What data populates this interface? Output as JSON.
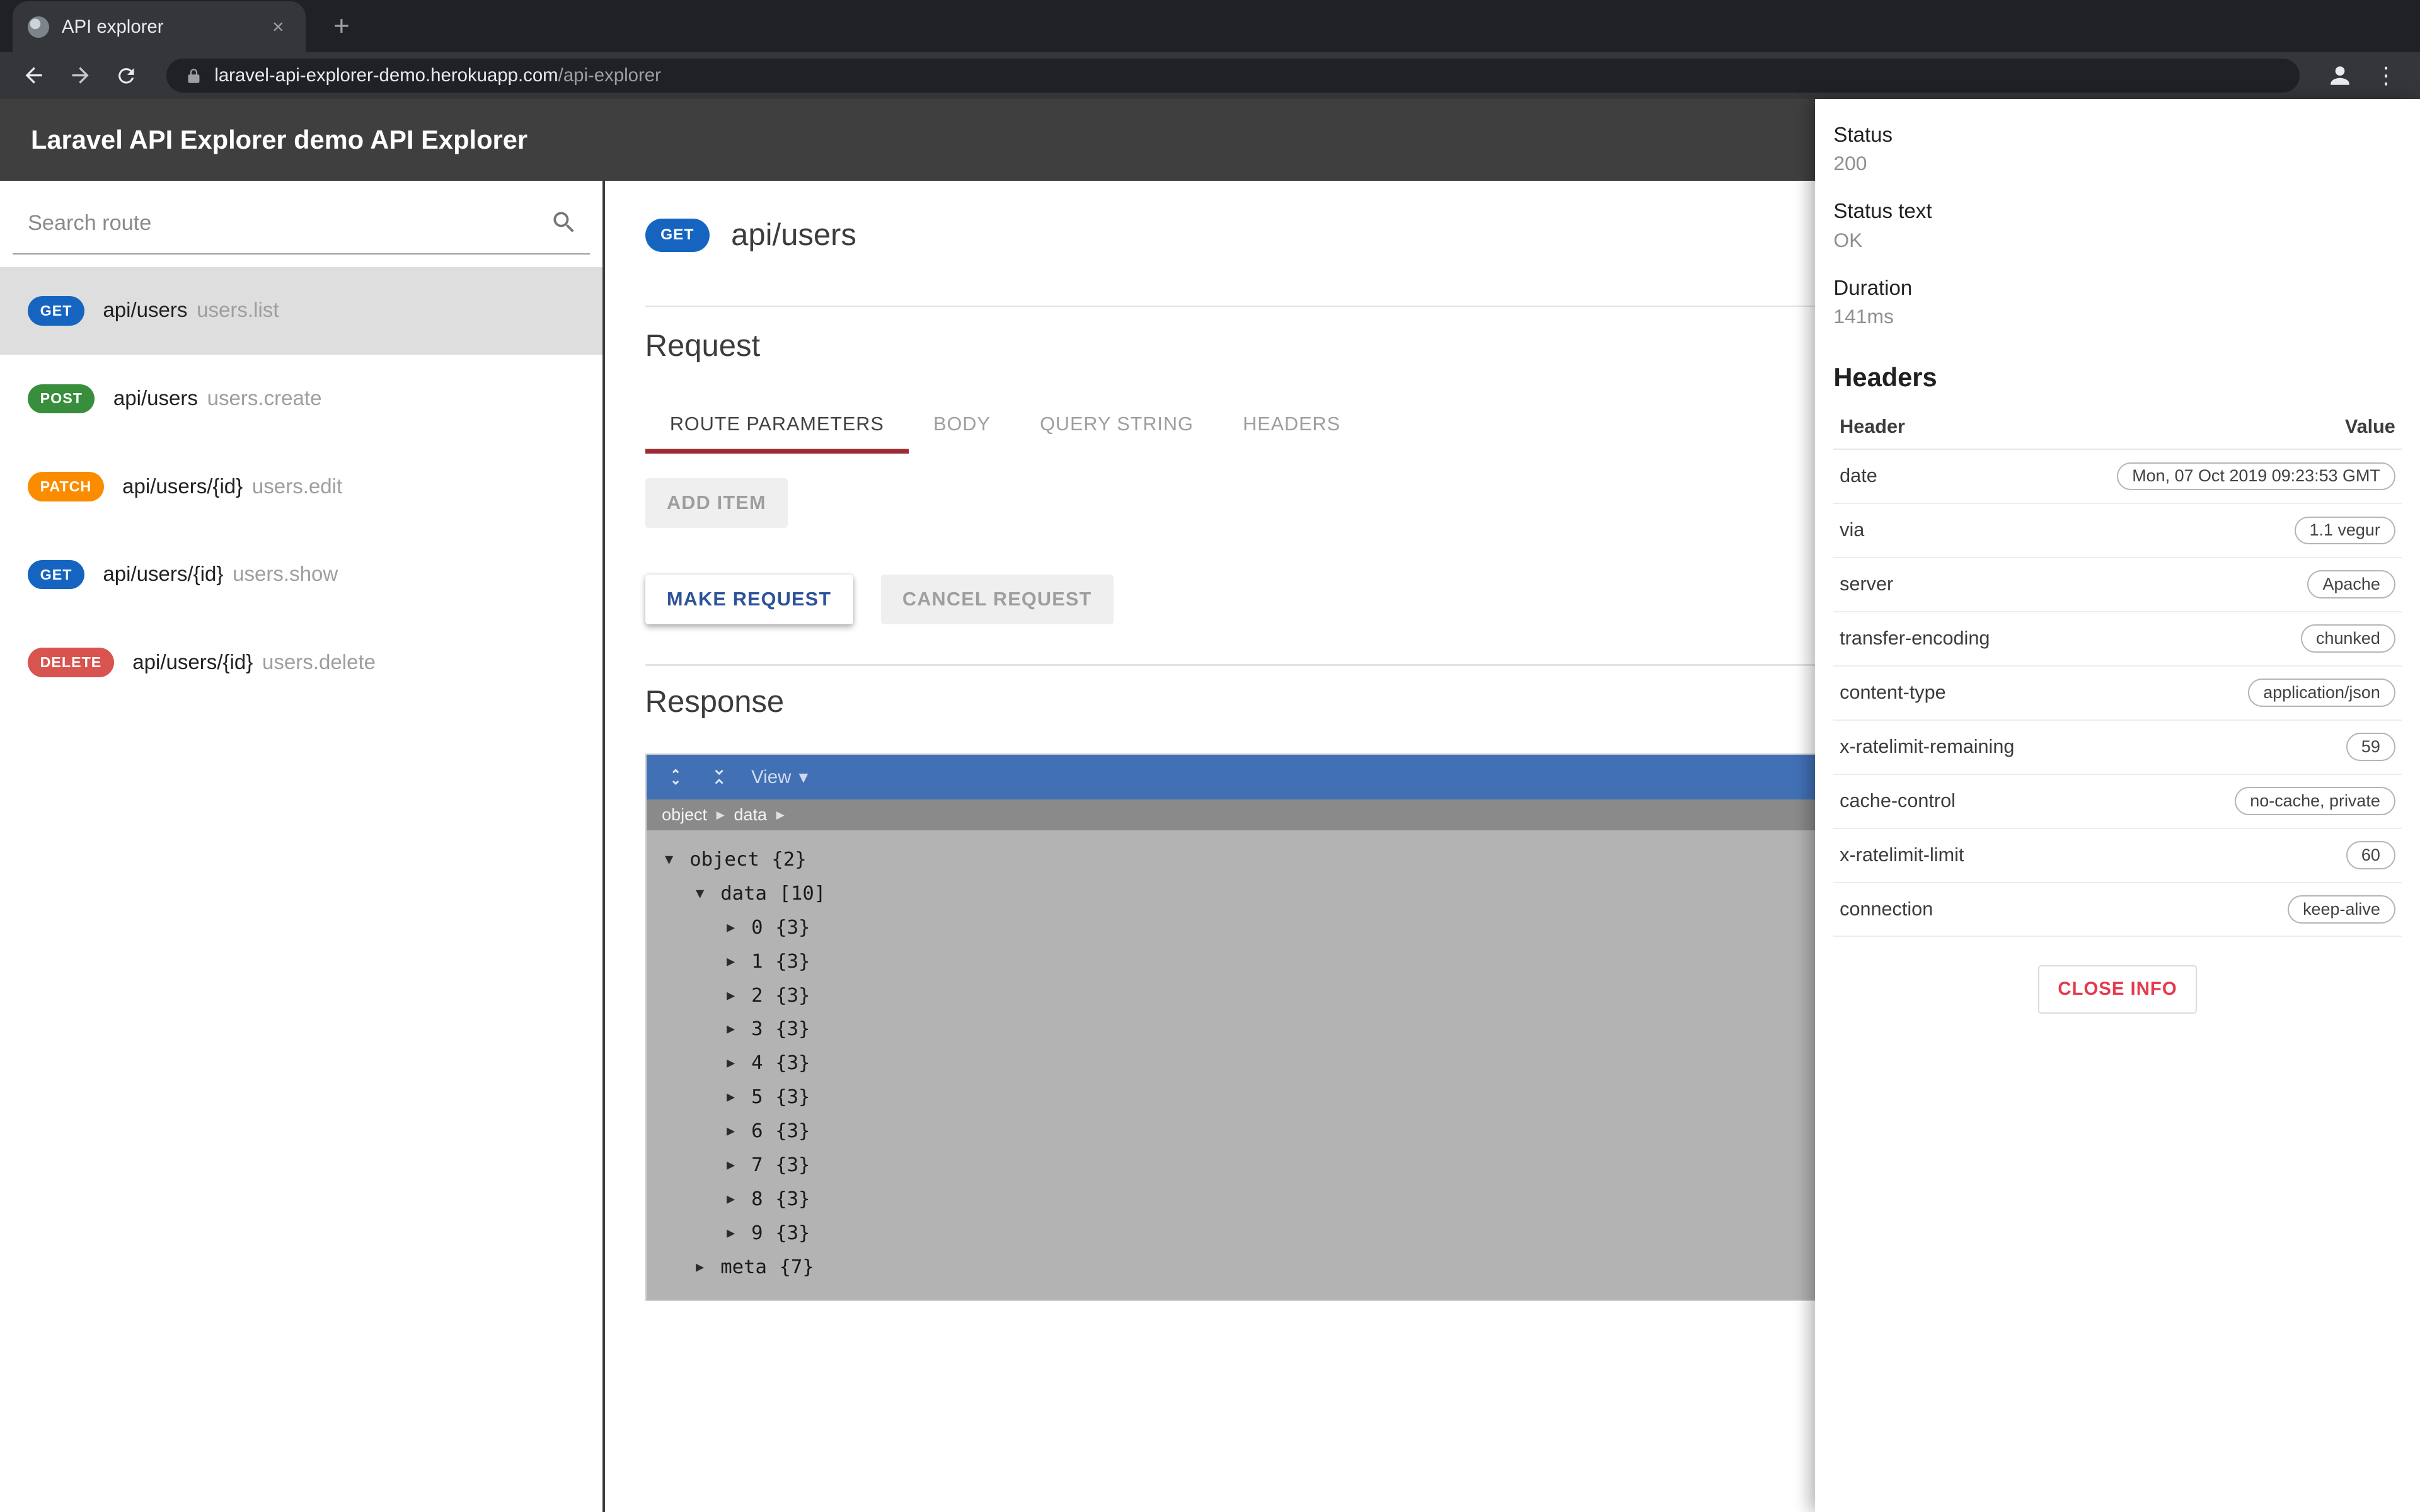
{
  "browser": {
    "tab_title": "API explorer",
    "url_domain": "laravel-api-explorer-demo.herokuapp.com",
    "url_path": "/api-explorer"
  },
  "glyphs": {
    "close": "×",
    "new_tab": "+",
    "kebab": "⋮",
    "caret_down": "▾",
    "crumb_sep": "▶"
  },
  "app_header": {
    "title": "Laravel API Explorer demo API Explorer"
  },
  "sidebar": {
    "search_placeholder": "Search route",
    "routes": [
      {
        "method": "GET",
        "path": "api/users",
        "name": "users.list",
        "selected": true
      },
      {
        "method": "POST",
        "path": "api/users",
        "name": "users.create"
      },
      {
        "method": "PATCH",
        "path": "api/users/{id}",
        "name": "users.edit"
      },
      {
        "method": "GET",
        "path": "api/users/{id}",
        "name": "users.show"
      },
      {
        "method": "DELETE",
        "path": "api/users/{id}",
        "name": "users.delete"
      }
    ]
  },
  "main": {
    "route_method": "GET",
    "route_path": "api/users",
    "request": {
      "title": "Request",
      "tabs": [
        {
          "label": "ROUTE PARAMETERS",
          "active": true
        },
        {
          "label": "BODY"
        },
        {
          "label": "QUERY STRING"
        },
        {
          "label": "HEADERS"
        }
      ],
      "add_item_label": "ADD ITEM",
      "make_request_label": "MAKE REQUEST",
      "cancel_request_label": "CANCEL REQUEST"
    },
    "response": {
      "title": "Response",
      "viewer": {
        "view_label": "View",
        "crumb_sep": "▶",
        "breadcrumb": [
          "object",
          "data"
        ],
        "tree": [
          {
            "arrow": "▼",
            "label": "object",
            "suffix": "{2}",
            "indent": 0
          },
          {
            "arrow": "▼",
            "label": "data",
            "suffix": "[10]",
            "indent": 1
          },
          {
            "arrow": "▶",
            "label": "0",
            "suffix": "{3}",
            "indent": 2
          },
          {
            "arrow": "▶",
            "label": "1",
            "suffix": "{3}",
            "indent": 2
          },
          {
            "arrow": "▶",
            "label": "2",
            "suffix": "{3}",
            "indent": 2
          },
          {
            "arrow": "▶",
            "label": "3",
            "suffix": "{3}",
            "indent": 2
          },
          {
            "arrow": "▶",
            "label": "4",
            "suffix": "{3}",
            "indent": 2
          },
          {
            "arrow": "▶",
            "label": "5",
            "suffix": "{3}",
            "indent": 2
          },
          {
            "arrow": "▶",
            "label": "6",
            "suffix": "{3}",
            "indent": 2
          },
          {
            "arrow": "▶",
            "label": "7",
            "suffix": "{3}",
            "indent": 2
          },
          {
            "arrow": "▶",
            "label": "8",
            "suffix": "{3}",
            "indent": 2
          },
          {
            "arrow": "▶",
            "label": "9",
            "suffix": "{3}",
            "indent": 2
          },
          {
            "arrow": "▶",
            "label": "meta",
            "suffix": "{7}",
            "indent": 1
          }
        ]
      }
    }
  },
  "info_panel": {
    "status_label": "Status",
    "status_value": "200",
    "status_text_label": "Status text",
    "status_text_value": "OK",
    "duration_label": "Duration",
    "duration_value": "141ms",
    "headers_title": "Headers",
    "table": {
      "header_col": "Header",
      "value_col": "Value",
      "rows": [
        {
          "name": "date",
          "value": "Mon, 07 Oct 2019 09:23:53 GMT"
        },
        {
          "name": "via",
          "value": "1.1 vegur"
        },
        {
          "name": "server",
          "value": "Apache"
        },
        {
          "name": "transfer-encoding",
          "value": "chunked"
        },
        {
          "name": "content-type",
          "value": "application/json"
        },
        {
          "name": "x-ratelimit-remaining",
          "value": "59"
        },
        {
          "name": "cache-control",
          "value": "no-cache, private"
        },
        {
          "name": "x-ratelimit-limit",
          "value": "60"
        },
        {
          "name": "connection",
          "value": "keep-alive"
        }
      ]
    },
    "close_label": "CLOSE INFO"
  },
  "colors": {
    "get_blue": "#1565c0",
    "post_green": "#388e3c",
    "patch_orange": "#fb8c00",
    "delete_red": "#d9534f",
    "viewer_toolbar_blue": "#4170b5",
    "tab_underline": "#9e2b33",
    "close_info_red": "#e5394e",
    "app_header_gray": "#3f3f3f",
    "selected_route_gray": "#dedede"
  }
}
